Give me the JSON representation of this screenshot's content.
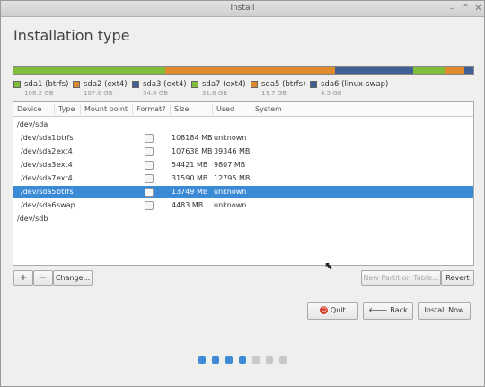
{
  "window": {
    "title": "Install"
  },
  "page": {
    "title": "Installation type"
  },
  "colors": {
    "btrfs": "#7fbd3a",
    "ext4": "#e08a2e",
    "ext4_alt": "#3f5f95",
    "swap": "#3f5f95",
    "selection": "#3b8ad6",
    "dot_active": "#3f8ad6",
    "dot_inactive": "#c8c8c8"
  },
  "legend": [
    {
      "name": "sda1 (btrfs)",
      "size": "108.2 GB",
      "color": "#7fbd3a"
    },
    {
      "name": "sda2 (ext4)",
      "size": "107.6 GB",
      "color": "#e08a2e"
    },
    {
      "name": "sda3 (ext4)",
      "size": "54.4 GB",
      "color": "#3f5f95"
    },
    {
      "name": "sda7 (ext4)",
      "size": "31.6 GB",
      "color": "#7fbd3a"
    },
    {
      "name": "sda5 (btrfs)",
      "size": "13.7 GB",
      "color": "#e08a2e"
    },
    {
      "name": "sda6 (linux-swap)",
      "size": "4.5 GB",
      "color": "#3f5f95"
    }
  ],
  "table": {
    "headers": [
      "Device",
      "Type",
      "Mount point",
      "Format?",
      "Size",
      "Used",
      "System"
    ],
    "rows": [
      {
        "device": "/dev/sda",
        "type": "",
        "mount": "",
        "format": false,
        "size": "",
        "used": "",
        "system": "",
        "is_disk": true
      },
      {
        "device": "/dev/sda1",
        "type": "btrfs",
        "mount": "",
        "format": false,
        "size": "108184 MB",
        "used": "unknown",
        "system": ""
      },
      {
        "device": "/dev/sda2",
        "type": "ext4",
        "mount": "",
        "format": false,
        "size": "107638 MB",
        "used": "39346 MB",
        "system": ""
      },
      {
        "device": "/dev/sda3",
        "type": "ext4",
        "mount": "",
        "format": false,
        "size": "54421 MB",
        "used": "9807 MB",
        "system": ""
      },
      {
        "device": "/dev/sda7",
        "type": "ext4",
        "mount": "",
        "format": false,
        "size": "31590 MB",
        "used": "12795 MB",
        "system": ""
      },
      {
        "device": "/dev/sda5",
        "type": "btrfs",
        "mount": "",
        "format": false,
        "size": "13749 MB",
        "used": "unknown",
        "system": "",
        "selected": true
      },
      {
        "device": "/dev/sda6",
        "type": "swap",
        "mount": "",
        "format": false,
        "size": "4483 MB",
        "used": "unknown",
        "system": ""
      },
      {
        "device": "/dev/sdb",
        "type": "",
        "mount": "",
        "format": false,
        "size": "",
        "used": "",
        "system": "",
        "is_disk": true
      }
    ]
  },
  "toolbar": {
    "add_label": "+",
    "remove_label": "−",
    "change_label": "Change...",
    "new_table_label": "New Partition Table...",
    "revert_label": "Revert"
  },
  "actions": {
    "quit_label": "Quit",
    "back_label": "Back",
    "install_label": "Install Now"
  },
  "progress": {
    "total_steps": 7,
    "completed_steps": 4
  }
}
